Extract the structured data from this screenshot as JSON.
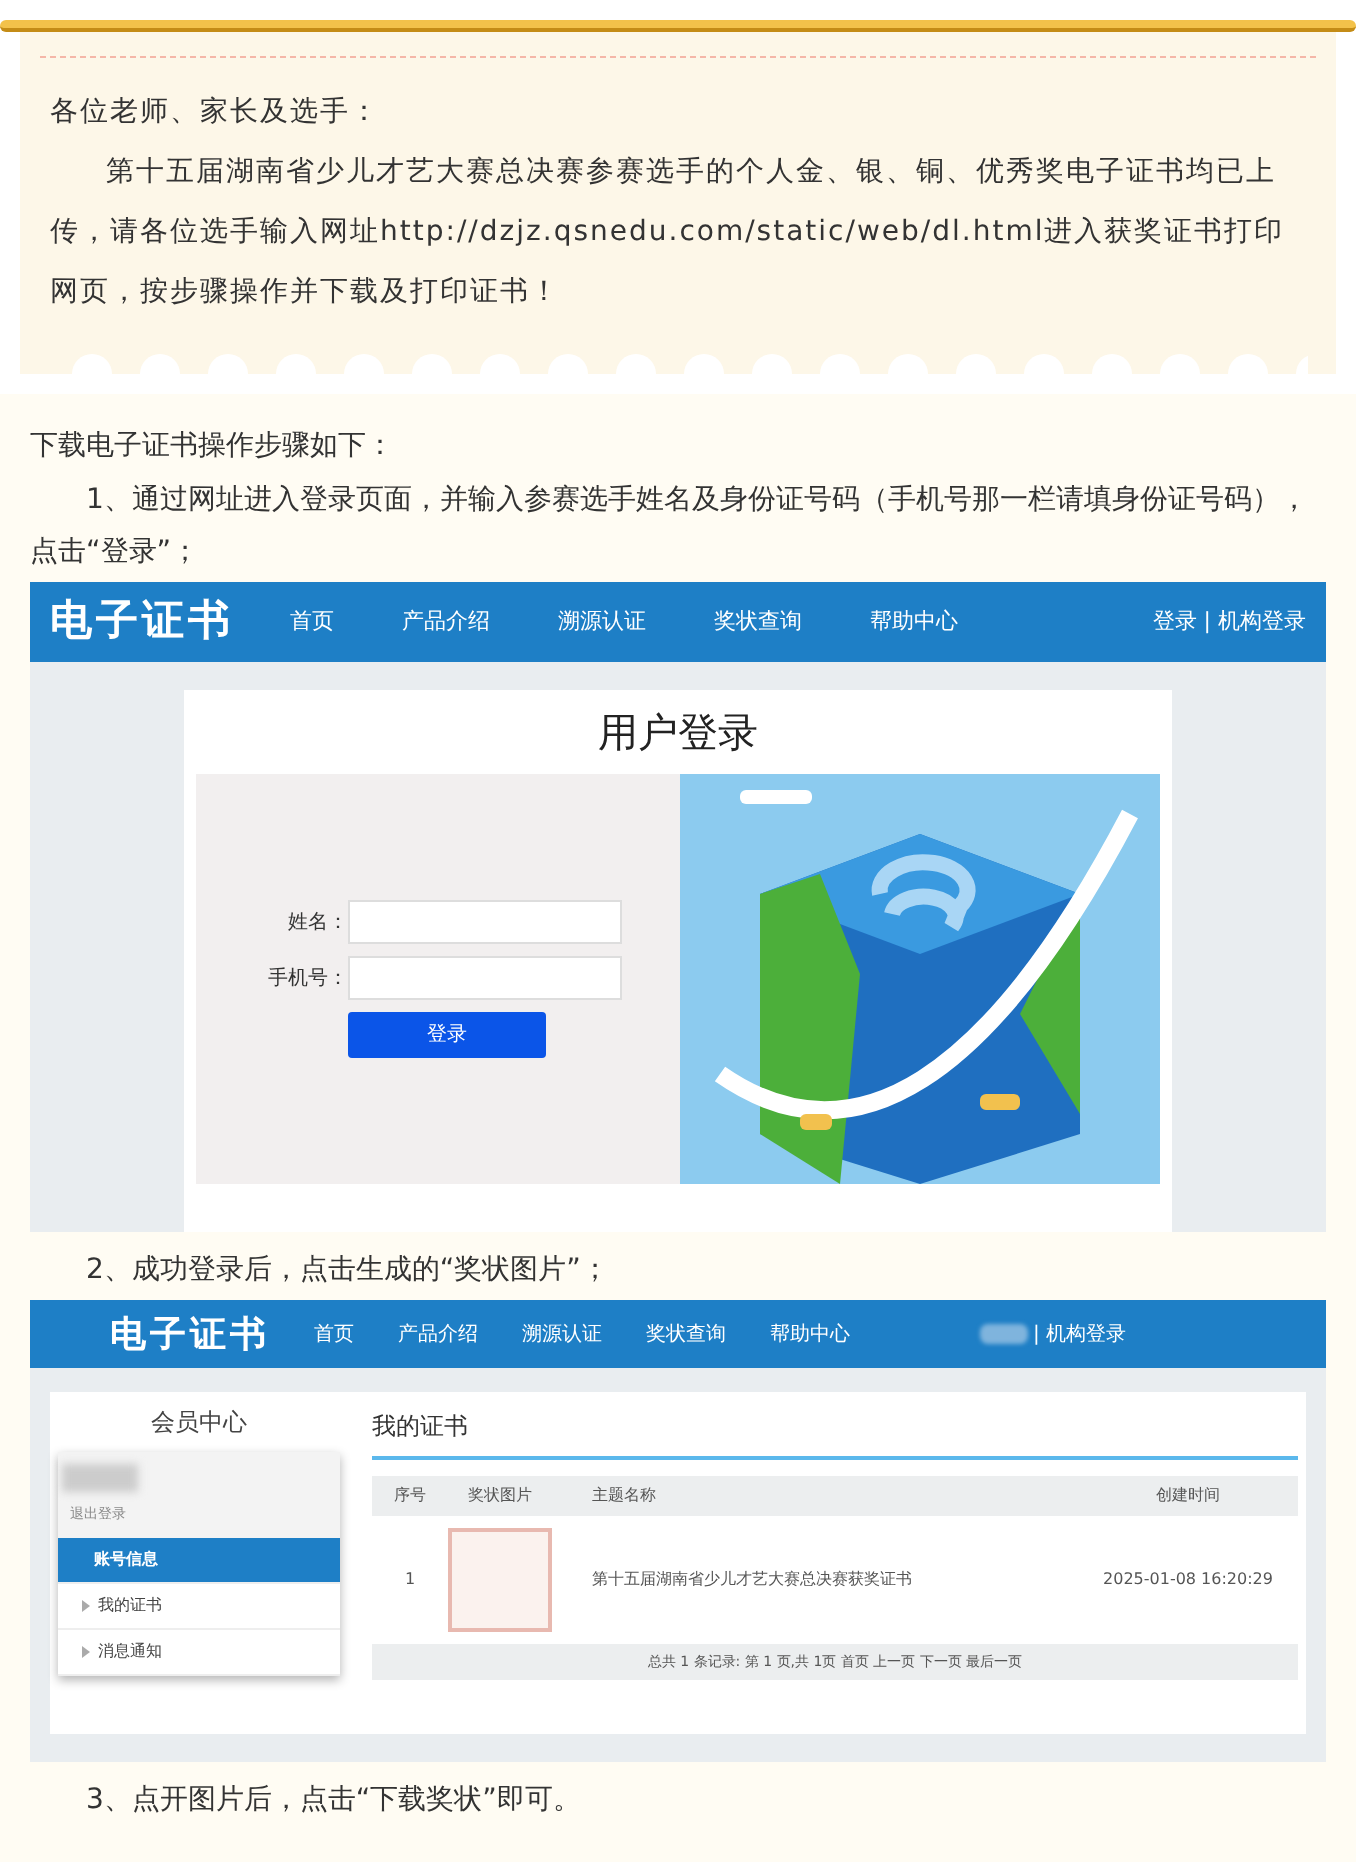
{
  "notice": {
    "greeting": "各位老师、家长及选手：",
    "body": "第十五届湖南省少儿才艺大赛总决赛参赛选手的个人金、银、铜、优秀奖电子证书均已上传，请各位选手输入网址http://dzjz.qsnedu.com/static/web/dl.html进入获奖证书打印网页，按步骤操作并下载及打印证书！"
  },
  "steps_intro": "下载电子证书操作步骤如下：",
  "steps": [
    {
      "kind": "login",
      "text": "1、通过网址进入登录页面，并输入参赛选手姓名及身份证号码（手机号那一栏请填身份证号码），点击“登录”；"
    },
    {
      "kind": "list",
      "text": "2、成功登录后，点击生成的“奖状图片”；"
    },
    {
      "kind": "none",
      "text": "3、点开图片后，点击“下载奖状”即可。"
    }
  ],
  "login_screenshot": {
    "logo": "电子证书",
    "nav": [
      "首页",
      "产品介绍",
      "溯源认证",
      "奖状查询",
      "帮助中心"
    ],
    "account_links": "登录 | 机构登录",
    "title": "用户登录",
    "fields": [
      {
        "label": "姓名："
      },
      {
        "label": "手机号："
      }
    ],
    "button": "登录"
  },
  "list_screenshot": {
    "logo": "电子证书",
    "nav": [
      "首页",
      "产品介绍",
      "溯源认证",
      "奖状查询",
      "帮助中心"
    ],
    "account_links": "| 机构登录",
    "sidebar_title": "会员中心",
    "logout": "退出登录",
    "menu": [
      {
        "label": "账号信息",
        "selected": true
      },
      {
        "label": "我的证书",
        "selected": false
      },
      {
        "label": "消息通知",
        "selected": false
      }
    ],
    "section_title": "我的证书",
    "columns": [
      "序号",
      "奖状图片",
      "主题名称",
      "创建时间"
    ],
    "rows": [
      {
        "index": "1",
        "title": "第十五届湖南省少儿才艺大赛总决赛获奖证书",
        "created": "2025-01-08 16:20:29"
      }
    ],
    "pagination": "总共 1 条记录: 第 1 页,共 1页 首页 上一页 下一页 最后一页"
  }
}
